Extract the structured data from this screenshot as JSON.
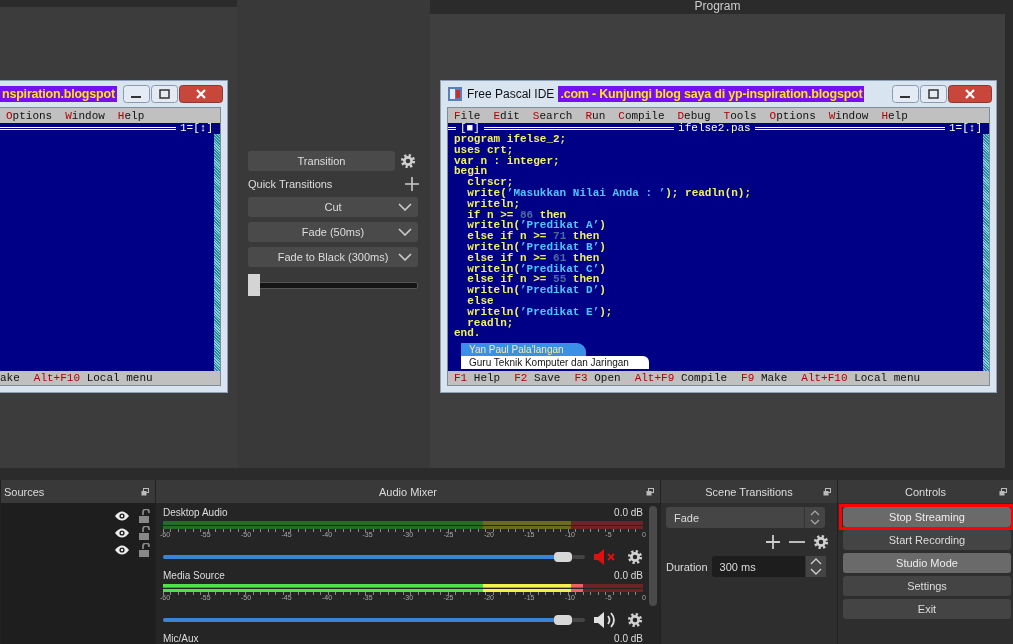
{
  "program_label": "Program",
  "preview": {
    "ide": {
      "banner": "nspiration.blogspot",
      "menu": [
        "Options",
        "Window",
        "Help"
      ],
      "editor_number": "1=[↕]",
      "status": [
        {
          "label": "ake"
        },
        {
          "key": "Alt+F10",
          "label": "Local menu"
        }
      ]
    }
  },
  "program": {
    "ide": {
      "app_title": "Free Pascal IDE",
      "banner": ".com - Kunjungi blog saya di yp-inspiration.blogspot",
      "menu": [
        "File",
        "Edit",
        "Search",
        "Run",
        "Compile",
        "Debug",
        "Tools",
        "Options",
        "Window",
        "Help"
      ],
      "close_box": "[■]",
      "file_title": "ifelse2.pas",
      "editor_number": "1=[↕]",
      "code": [
        [
          {
            "kind": "plain",
            "text": "program ifelse_2;"
          }
        ],
        [
          {
            "kind": "plain",
            "text": "uses crt;"
          }
        ],
        [
          {
            "kind": "plain",
            "text": "var n : integer;"
          }
        ],
        [
          {
            "kind": "plain",
            "text": "begin"
          }
        ],
        [
          {
            "kind": "plain",
            "text": "  clrscr;"
          }
        ],
        [
          {
            "kind": "plain",
            "text": "  write("
          },
          {
            "kind": "string",
            "text": "’Masukkan Nilai Anda : ’"
          },
          {
            "kind": "plain",
            "text": "); readln(n);"
          }
        ],
        [
          {
            "kind": "plain",
            "text": "  writeln;"
          }
        ],
        [
          {
            "kind": "plain",
            "text": "  if n >= "
          },
          {
            "kind": "number",
            "text": "86"
          },
          {
            "kind": "plain",
            "text": " then"
          }
        ],
        [
          {
            "kind": "plain",
            "text": "  writeln("
          },
          {
            "kind": "string",
            "text": "’Predikat A’"
          },
          {
            "kind": "plain",
            "text": ")"
          }
        ],
        [
          {
            "kind": "plain",
            "text": "  else if n >= "
          },
          {
            "kind": "number",
            "text": "71"
          },
          {
            "kind": "plain",
            "text": " then"
          }
        ],
        [
          {
            "kind": "plain",
            "text": "  writeln("
          },
          {
            "kind": "string",
            "text": "’Predikat B’"
          },
          {
            "kind": "plain",
            "text": ")"
          }
        ],
        [
          {
            "kind": "plain",
            "text": "  else if n >= "
          },
          {
            "kind": "number",
            "text": "61"
          },
          {
            "kind": "plain",
            "text": " then"
          }
        ],
        [
          {
            "kind": "plain",
            "text": "  writeln("
          },
          {
            "kind": "string",
            "text": "’Predikat C’"
          },
          {
            "kind": "plain",
            "text": ")"
          }
        ],
        [
          {
            "kind": "plain",
            "text": "  else if n >= "
          },
          {
            "kind": "number",
            "text": "55"
          },
          {
            "kind": "plain",
            "text": " then"
          }
        ],
        [
          {
            "kind": "plain",
            "text": "  writeln("
          },
          {
            "kind": "string",
            "text": "’Predikat D’"
          },
          {
            "kind": "plain",
            "text": ")"
          }
        ],
        [
          {
            "kind": "plain",
            "text": "  else"
          }
        ],
        [
          {
            "kind": "plain",
            "text": "  writeln("
          },
          {
            "kind": "string",
            "text": "’Predikat E’"
          },
          {
            "kind": "plain",
            "text": ");"
          }
        ],
        [
          {
            "kind": "plain",
            "text": "  readln;"
          }
        ],
        [
          {
            "kind": "plain",
            "text": "end."
          }
        ]
      ],
      "status": [
        {
          "key": "F1",
          "label": "Help"
        },
        {
          "key": "F2",
          "label": "Save"
        },
        {
          "key": "F3",
          "label": "Open"
        },
        {
          "key": "Alt+F9",
          "label": "Compile"
        },
        {
          "key": "F9",
          "label": "Make"
        },
        {
          "key": "Alt+F10",
          "label": "Local menu"
        }
      ],
      "lower_third": {
        "name": "Yan Paul Pala'langan",
        "title": "Guru Teknik Komputer dan Jaringan"
      }
    }
  },
  "transitions": {
    "transition_button": "Transition",
    "quick_label": "Quick Transitions",
    "quick": [
      "Cut",
      "Fade (50ms)",
      "Fade to Black (300ms)"
    ],
    "tbar": {
      "level": 0
    }
  },
  "sources": {
    "title": "Sources",
    "items": [
      {
        "visible": true,
        "locked": false
      },
      {
        "visible": true,
        "locked": false
      },
      {
        "visible": true,
        "locked": false
      }
    ]
  },
  "mixer": {
    "title": "Audio Mixer",
    "channels": [
      {
        "name": "Desktop Audio",
        "reading": "0.0 dB",
        "muted": true,
        "meter": {
          "level": 0
        },
        "scale": [
          "-60",
          "-55",
          "-50",
          "-45",
          "-40",
          "-35",
          "-30",
          "-25",
          "-20",
          "-15",
          "-10",
          "-5",
          "0"
        ],
        "volume": {
          "level": 0.97
        }
      },
      {
        "name": "Media Source",
        "reading": "0.0 dB",
        "muted": false,
        "meter": {
          "level": 0.875
        },
        "scale": [
          "-60",
          "-55",
          "-50",
          "-45",
          "-40",
          "-35",
          "-30",
          "-25",
          "-20",
          "-15",
          "-10",
          "-5",
          "0"
        ],
        "volume": {
          "level": 0.97
        }
      },
      {
        "name": "Mic/Aux",
        "reading": "0.0 dB"
      }
    ]
  },
  "scene_transitions": {
    "title": "Scene Transitions",
    "transition": "Fade",
    "duration_label": "Duration",
    "duration": "300 ms"
  },
  "controls": {
    "title": "Controls",
    "buttons": [
      {
        "label": "Stop Streaming",
        "on": true,
        "highlighted": true
      },
      {
        "label": "Start Recording",
        "on": false,
        "highlighted": false
      },
      {
        "label": "Studio Mode",
        "on": true,
        "highlighted": false
      },
      {
        "label": "Settings",
        "on": false,
        "highlighted": false
      },
      {
        "label": "Exit",
        "on": false,
        "highlighted": false
      }
    ]
  }
}
